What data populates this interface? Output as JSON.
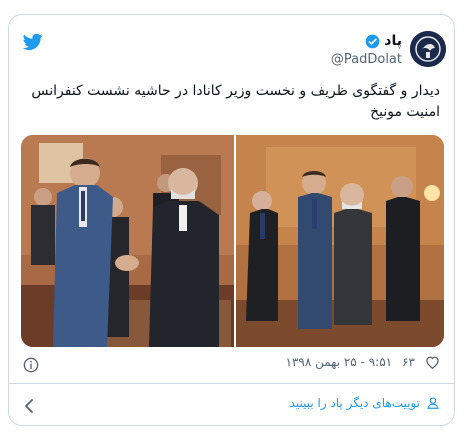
{
  "tweet": {
    "name": "پاد",
    "handle": "@PadDolat",
    "text": "دیدار و گفتگوی ظریف و نخست وزیر کانادا در حاشیه نشست کنفرانس امنیت مونیخ",
    "likes": "۶۳",
    "timestamp": "۹:۵۱ - ۲۵ بهمن ۱۳۹۸",
    "footer_link": "توییت‌های دیگر پاد را ببینید"
  },
  "icons": {
    "brand": "twitter-bird-icon",
    "verified": "verified-badge-icon",
    "like": "heart-icon",
    "info": "info-icon",
    "user": "user-icon",
    "chevron": "chevron-left-icon"
  },
  "colors": {
    "accent": "#1d9bf0",
    "text": "#0f1419",
    "muted": "#536471",
    "border": "#cfd9de"
  }
}
